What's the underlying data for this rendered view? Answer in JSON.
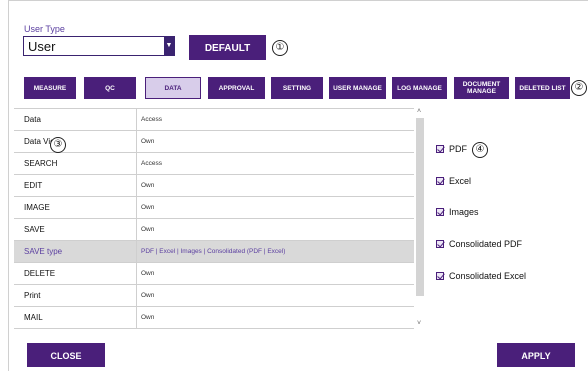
{
  "user_type": {
    "label": "User Type",
    "selected": "User",
    "default_button": "DEFAULT"
  },
  "callouts": [
    "①",
    "②",
    "③",
    "④"
  ],
  "tabs": [
    {
      "label": "MEASURE",
      "active": false
    },
    {
      "label": "QC",
      "active": false
    },
    {
      "label": "DATA",
      "active": true
    },
    {
      "label": "APPROVAL",
      "active": false
    },
    {
      "label": "SETTING",
      "active": false
    },
    {
      "label": "USER MANAGE",
      "active": false
    },
    {
      "label": "LOG MANAGE",
      "active": false
    },
    {
      "label": "DOCUMENT MANAGE",
      "active": false
    },
    {
      "label": "DELETED LIST",
      "active": false
    }
  ],
  "rows": [
    {
      "name": "Data",
      "value": "Access"
    },
    {
      "name": "Data View",
      "value": "Own"
    },
    {
      "name": "SEARCH",
      "value": "Access"
    },
    {
      "name": "EDIT",
      "value": "Own"
    },
    {
      "name": "IMAGE",
      "value": "Own"
    },
    {
      "name": "SAVE",
      "value": "Own"
    },
    {
      "name": "SAVE type",
      "value": "PDF | Excel | Images | Consolidated (PDF | Excel)",
      "selected": true
    },
    {
      "name": "DELETE",
      "value": "Own"
    },
    {
      "name": "Print",
      "value": "Own"
    },
    {
      "name": "MAIL",
      "value": "Own"
    }
  ],
  "save_types": [
    {
      "label": "PDF",
      "checked": true
    },
    {
      "label": "Excel",
      "checked": true
    },
    {
      "label": "Images",
      "checked": true
    },
    {
      "label": "Consolidated PDF",
      "checked": true
    },
    {
      "label": "Consolidated Excel",
      "checked": true
    }
  ],
  "footer": {
    "close": "CLOSE",
    "apply": "APPLY"
  },
  "colors": {
    "accent": "#4a1f7a",
    "accent_light": "#d8cdea",
    "selected_row": "#d9d9d9"
  }
}
